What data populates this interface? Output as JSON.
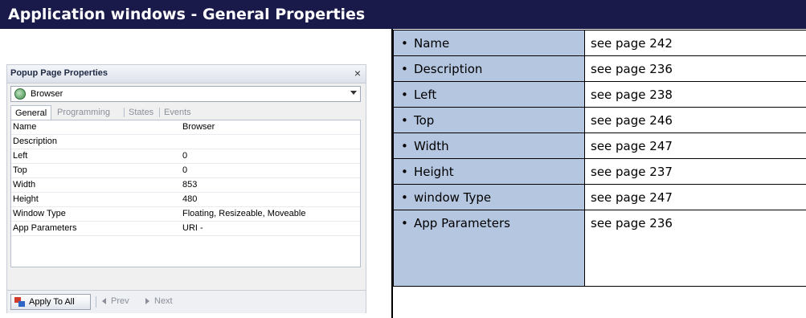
{
  "header": {
    "title": "Application windows - General Properties"
  },
  "dialog": {
    "title": "Popup Page Properties",
    "close_glyph": "×",
    "selected_page": "Browser",
    "tabs": [
      "General",
      "Programming",
      "States",
      "Events"
    ],
    "active_tab": "General",
    "properties": [
      {
        "name": "Name",
        "value": "Browser"
      },
      {
        "name": "Description",
        "value": ""
      },
      {
        "name": "Left",
        "value": "0"
      },
      {
        "name": "Top",
        "value": "0"
      },
      {
        "name": "Width",
        "value": "853"
      },
      {
        "name": "Height",
        "value": "480"
      },
      {
        "name": "Window Type",
        "value": "Floating, Resizeable, Moveable"
      },
      {
        "name": "App Parameters",
        "value": "URI -"
      }
    ],
    "footer": {
      "apply_label": "Apply To All",
      "prev_label": "Prev",
      "next_label": "Next"
    }
  },
  "table": {
    "bullet": "•",
    "rows": [
      {
        "property": "Name",
        "reference": "see page 242"
      },
      {
        "property": "Description",
        "reference": "see page 236"
      },
      {
        "property": "Left",
        "reference": "see page 238"
      },
      {
        "property": "Top",
        "reference": "see page 246"
      },
      {
        "property": "Width",
        "reference": "see page 247"
      },
      {
        "property": "Height",
        "reference": "see page 237"
      },
      {
        "property": "window Type",
        "reference": "see page 247"
      },
      {
        "property": "App Parameters",
        "reference": "see page 236"
      }
    ]
  },
  "colors": {
    "header_bg": "#1a1a4a",
    "prop_cell_bg": "#b4c6e0"
  }
}
